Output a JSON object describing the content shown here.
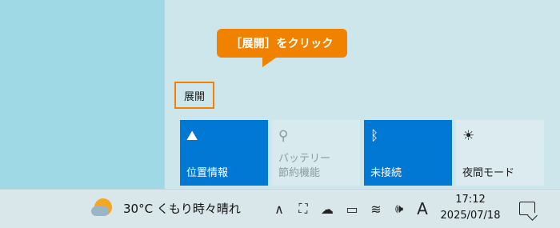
{
  "callout": {
    "text": "［展開］をクリック"
  },
  "action_center": {
    "expand_label": "展開",
    "tiles": [
      {
        "label": "位置情報",
        "icon": "location-icon",
        "glyph": "⛰",
        "state": "on"
      },
      {
        "label": "バッテリー\n節約機能",
        "icon": "battery-saver-icon",
        "glyph": "⚲",
        "state": "disabled"
      },
      {
        "label": "未接続",
        "icon": "bluetooth-icon",
        "glyph": "ᛒ",
        "state": "on"
      },
      {
        "label": "夜間モード",
        "icon": "night-light-icon",
        "glyph": "☀",
        "state": "off"
      }
    ]
  },
  "taskbar": {
    "weather": {
      "text": "30°C くもり時々晴れ",
      "icon": "partly-cloudy-icon"
    },
    "tray": {
      "chevron": "∧",
      "camera": "⛶",
      "onedrive": "☁",
      "battery": "▭",
      "wifi": "≋",
      "volume": "🕪",
      "ime": "A"
    },
    "clock": {
      "time": "17:12",
      "date": "2025/07/18"
    }
  },
  "colors": {
    "accent": "#0078d4",
    "callout": "#f08200",
    "desktop": "#9fd9e6",
    "action_center_bg": "#cde6ec"
  }
}
